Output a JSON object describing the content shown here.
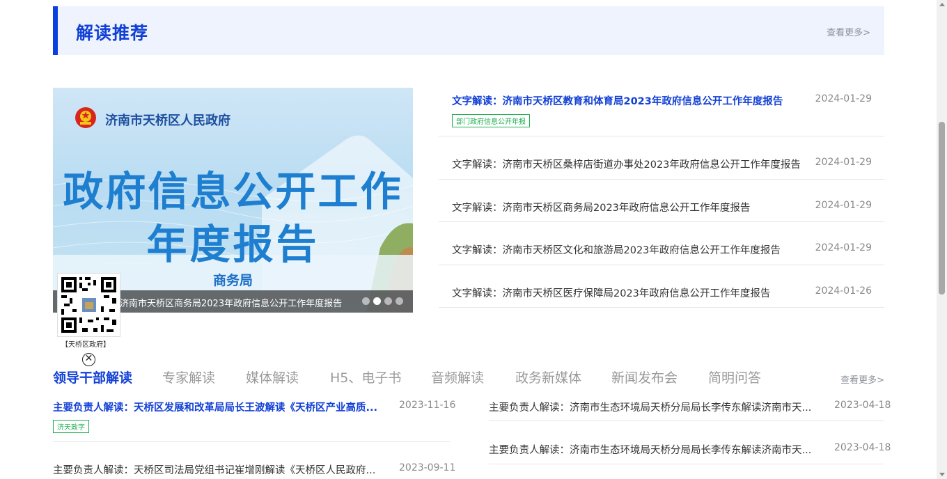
{
  "section": {
    "title": "解读推荐",
    "more": "查看更多>"
  },
  "banner": {
    "gov_name": "济南市天桥区人民政府",
    "headline1": "政府信息公开工作",
    "headline2": "年度报告",
    "dept": "商务局",
    "caption": "济南市天桥区商务局2023年政府信息公开工作年度报告",
    "slides": 4,
    "active_slide": 2
  },
  "qr": {
    "caption": "【天桥区政府】",
    "close": "✕"
  },
  "news": [
    {
      "title": "文字解读：济南市天桥区教育和体育局2023年政府信息公开工作年度报告",
      "date": "2024-01-29",
      "tag": "部门政府信息公开年报"
    },
    {
      "title": "文字解读：济南市天桥区桑梓店街道办事处2023年政府信息公开工作年度报告",
      "date": "2024-01-29"
    },
    {
      "title": "文字解读：济南市天桥区商务局2023年政府信息公开工作年度报告",
      "date": "2024-01-29"
    },
    {
      "title": "文字解读：济南市天桥区文化和旅游局2023年政府信息公开工作年度报告",
      "date": "2024-01-29"
    },
    {
      "title": "文字解读：济南市天桥区医疗保障局2023年政府信息公开工作年度报告",
      "date": "2024-01-26"
    }
  ],
  "tabs": {
    "items": [
      "领导干部解读",
      "专家解读",
      "媒体解读",
      "H5、电子书",
      "音频解读",
      "政务新媒体",
      "新闻发布会",
      "简明问答"
    ],
    "active": 0,
    "more": "查看更多>"
  },
  "lead_left": [
    {
      "title": "主要负责人解读：天桥区发展和改革局局长王波解读《天桥区产业高质...",
      "date": "2023-11-16",
      "tag": "济天政字"
    },
    {
      "title": "主要负责人解读：天桥区司法局党组书记崔增刚解读《天桥区人民政府...",
      "date": "2023-09-11"
    }
  ],
  "lead_right": [
    {
      "title": "主要负责人解读：济南市生态环境局天桥分局局长李传东解读济南市天...",
      "date": "2023-04-18"
    },
    {
      "title": "主要负责人解读：济南市生态环境局天桥分局局长李传东解读济南市天...",
      "date": "2023-04-18"
    }
  ],
  "colors": {
    "accent": "#1240d6",
    "tag_green": "#1fae51",
    "header_bg": "#eef3fe"
  }
}
